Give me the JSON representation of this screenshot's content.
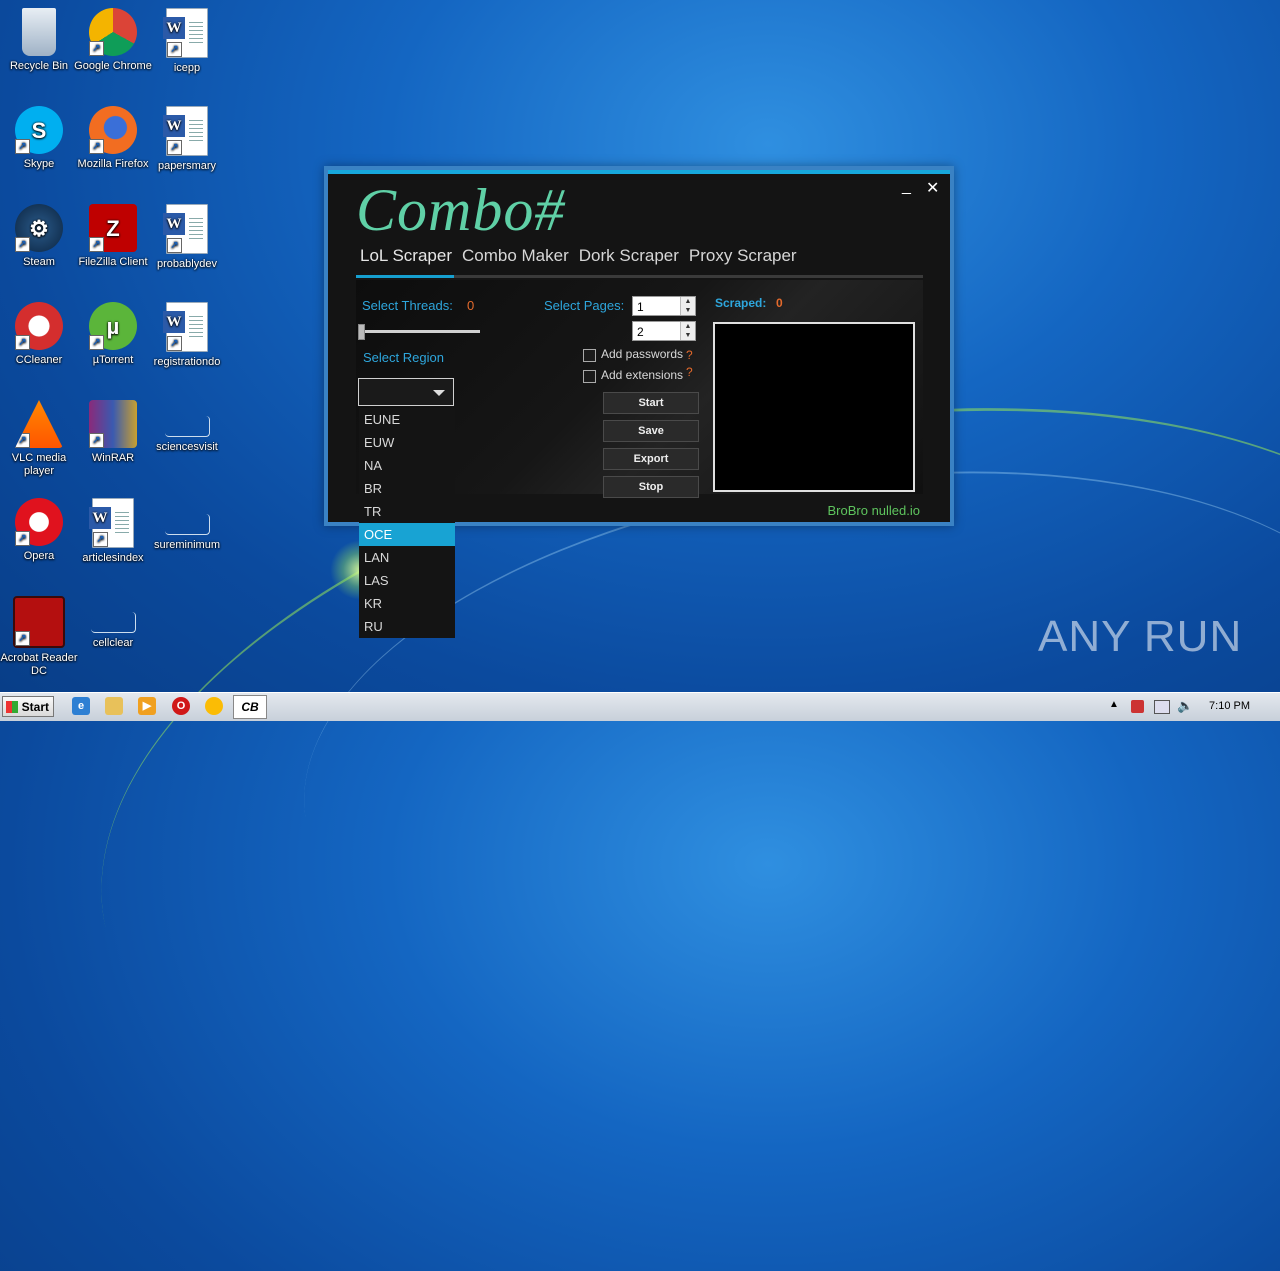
{
  "desktop": {
    "icons": [
      {
        "label": "Recycle Bin",
        "icon": "recycle-bin-icon"
      },
      {
        "label": "Google Chrome",
        "icon": "chrome-icon"
      },
      {
        "label": "icepp",
        "icon": "word-document-icon"
      },
      {
        "label": "Skype",
        "icon": "skype-icon"
      },
      {
        "label": "Mozilla Firefox",
        "icon": "firefox-icon"
      },
      {
        "label": "papersmary",
        "icon": "word-document-icon"
      },
      {
        "label": "Steam",
        "icon": "steam-icon"
      },
      {
        "label": "FileZilla Client",
        "icon": "filezilla-icon"
      },
      {
        "label": "probablydev",
        "icon": "word-document-icon"
      },
      {
        "label": "CCleaner",
        "icon": "ccleaner-icon"
      },
      {
        "label": "µTorrent",
        "icon": "utorrent-icon"
      },
      {
        "label": "registrationdo",
        "icon": "word-document-icon"
      },
      {
        "label": "VLC media player",
        "icon": "vlc-icon"
      },
      {
        "label": "WinRAR",
        "icon": "winrar-icon"
      },
      {
        "label": "sciencesvisit",
        "icon": "blank-document-icon"
      },
      {
        "label": "Opera",
        "icon": "opera-icon"
      },
      {
        "label": "articlesindex",
        "icon": "word-document-icon"
      },
      {
        "label": "sureminimum",
        "icon": "blank-document-icon"
      },
      {
        "label": "Acrobat Reader DC",
        "icon": "acrobat-icon"
      },
      {
        "label": "cellclear",
        "icon": "blank-document-icon"
      }
    ]
  },
  "app": {
    "logo": "Combo#",
    "minimize": "_",
    "close": "✕",
    "tabs": [
      "LoL Scraper",
      "Combo Maker",
      "Dork Scraper",
      "Proxy Scraper"
    ],
    "active_tab": "LoL Scraper",
    "threads_label": "Select Threads:",
    "threads_value": "0",
    "threads_level": 0,
    "region_label": "Select Region",
    "region_selected": "",
    "region_options": [
      "EUNE",
      "EUW",
      "NA",
      "BR",
      "TR",
      "OCE",
      "LAN",
      "LAS",
      "KR",
      "RU"
    ],
    "region_highlighted": "OCE",
    "pages_label": "Select Pages:",
    "pages_from": "1",
    "pages_to": "2",
    "add_passwords": "Add passwords",
    "add_extensions": "Add extensions",
    "help": "?",
    "buttons": {
      "start": "Start",
      "save": "Save",
      "export": "Export",
      "stop": "Stop"
    },
    "scraped_label": "Scraped:",
    "scraped_value": "0",
    "credit": "BroBro nulled.io"
  },
  "taskbar": {
    "start": "Start",
    "active_app": "CB",
    "clock": "7:10 PM"
  },
  "watermark": "ANY RUN",
  "colors": {
    "accent": "#16a0d0",
    "orange": "#e46a2c",
    "logo": "#5fd0a6",
    "credit": "#5ec45e"
  }
}
